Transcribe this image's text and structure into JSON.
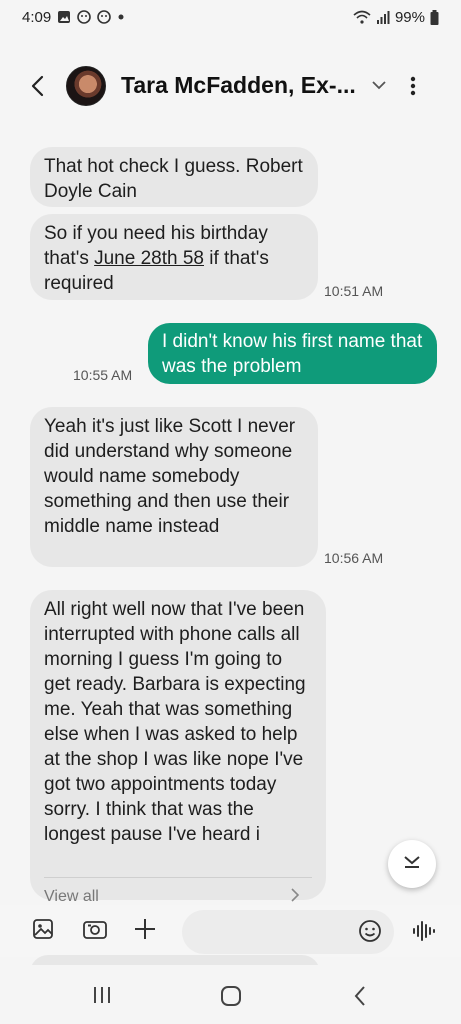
{
  "status_bar": {
    "time": "4:09",
    "battery": "99%"
  },
  "header": {
    "contact_name": "Tara McFadden, Ex-..."
  },
  "messages": [
    {
      "direction": "in",
      "text": "That hot check I guess. Robert Doyle Cain"
    },
    {
      "direction": "in",
      "text_before": "So if you need his birthday that's ",
      "link": "June 28th 58",
      "text_after": " if that's required",
      "time": "10:51 AM"
    },
    {
      "direction": "out",
      "text": "I didn't know his first name that was the problem",
      "time": "10:55 AM"
    },
    {
      "direction": "in",
      "text": "Yeah it's just like Scott I never did understand why someone would name somebody something and then use their middle name instead",
      "time": "10:56 AM"
    },
    {
      "direction": "in",
      "text": "All right well now that I've been interrupted with phone calls all morning I guess I'm going to get ready. Barbara is expecting me. Yeah that was something else when I was asked to help at the shop I was like nope I've got two appointments today sorry. I think that was the longest pause I've heard i",
      "view_all": "View all"
    }
  ],
  "icons": [
    "back-arrow-icon",
    "chevron-down-icon",
    "more-vert-icon",
    "gallery-icon",
    "camera-icon",
    "plus-icon",
    "emoji-icon",
    "voice-wave-icon",
    "scroll-down-icon",
    "recents-nav-icon",
    "home-nav-icon",
    "back-nav-icon"
  ],
  "colors": {
    "outgoing_bubble": "#0f9b7a",
    "incoming_bubble": "#e7e7e7",
    "background": "#f5f5f5"
  }
}
